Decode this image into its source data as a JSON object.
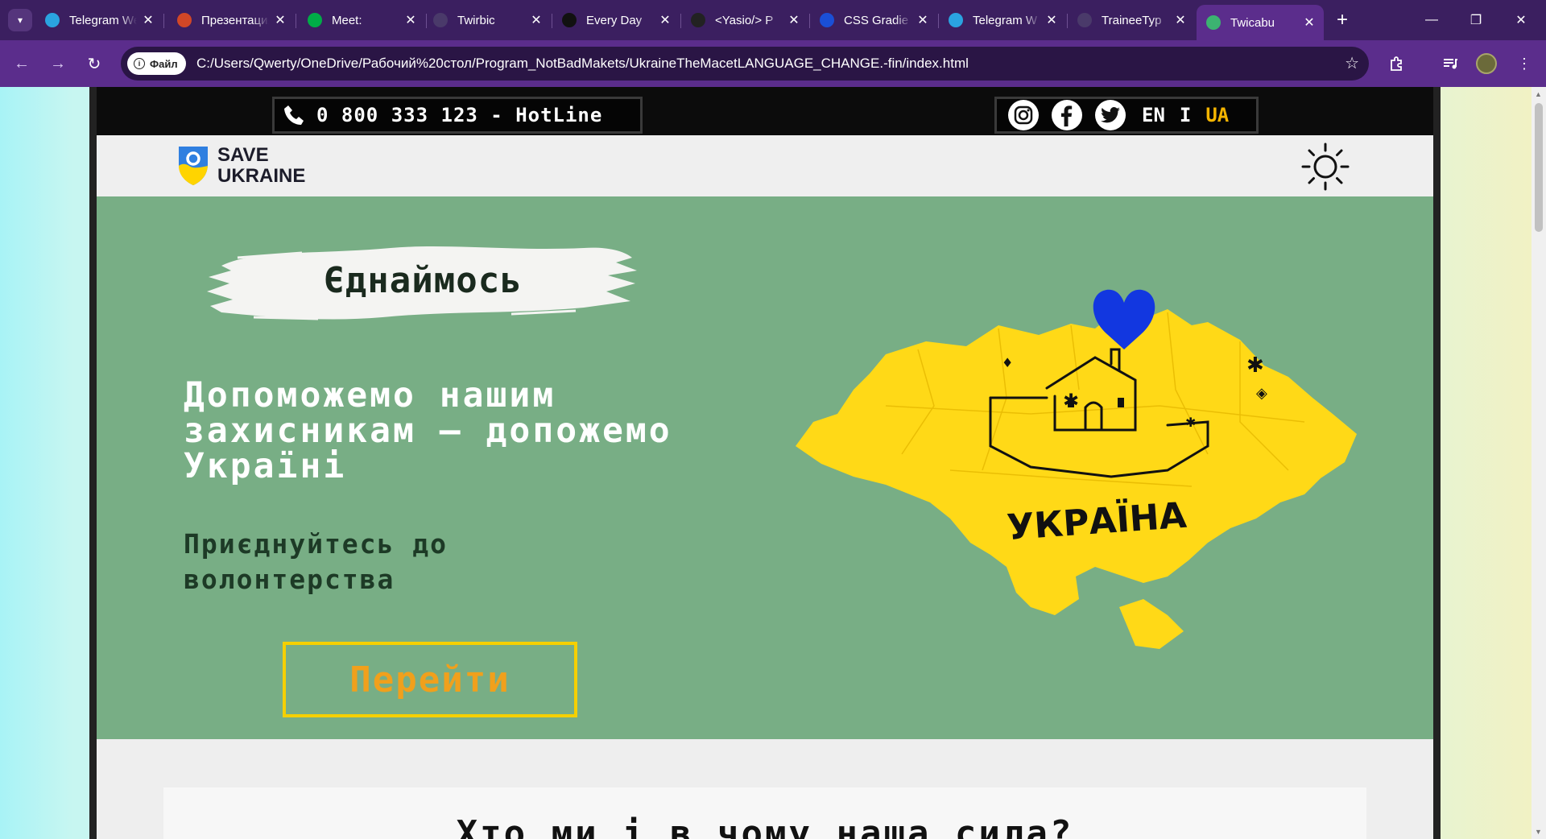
{
  "browser": {
    "tabs": [
      {
        "title": "Telegram Web",
        "favicon": "telegram-icon",
        "color": "#2aa3e0"
      },
      {
        "title": "Презентация",
        "favicon": "powerpoint-icon",
        "color": "#d24726"
      },
      {
        "title": "Meet: ",
        "favicon": "meet-icon",
        "color": "#00ac47"
      },
      {
        "title": "Twirbic",
        "favicon": "dark-circle-icon",
        "color": "#4a3a6a"
      },
      {
        "title": "Every Day",
        "favicon": "e-icon",
        "color": "#111111"
      },
      {
        "title": "<Yasio/> P",
        "favicon": "yasio-icon",
        "color": "#222222"
      },
      {
        "title": "CSS Gradie",
        "favicon": "gradient-icon",
        "color": "#1a4fd6"
      },
      {
        "title": "Telegram W",
        "favicon": "telegram-icon",
        "color": "#2aa3e0"
      },
      {
        "title": "TraineeTyp",
        "favicon": "dark-circle-icon",
        "color": "#4a3a6a"
      },
      {
        "title": "Twicabu",
        "favicon": "leaf-icon",
        "color": "#3cb371"
      }
    ],
    "active_tab": 9,
    "new_tab_label": "+",
    "file_chip": "Файл",
    "url": "C:/Users/Qwerty/OneDrive/Рабочий%20стол/Program_NotBadMakets/UkraineTheMacetLANGUAGE_CHANGE.-fin/index.html"
  },
  "site": {
    "hotline": "0 800 333 123 - HotLine",
    "lang_en": "EN",
    "lang_sep": "I",
    "lang_ua": "UA",
    "logo_line1": "SAVE",
    "logo_line2": "UKRAINE",
    "unite_label": "Єднаймось",
    "hero_title": "Допоможемо нашим захисникам — допожемо Україні",
    "hero_subtitle": "Приєднуйтесь до волонтерства",
    "go_button": "Перейти",
    "map_label": "УКРАЇНА",
    "section_title": "Хто ми і в чому наша сила?"
  },
  "colors": {
    "hero_bg": "#78ae85",
    "button_border": "#f5d000",
    "button_text": "#f0a01c",
    "accent_ua": "#f4b400",
    "map_yellow": "#ffd917",
    "heart_blue": "#1237e0",
    "browser_purple": "#5b2d8c"
  }
}
